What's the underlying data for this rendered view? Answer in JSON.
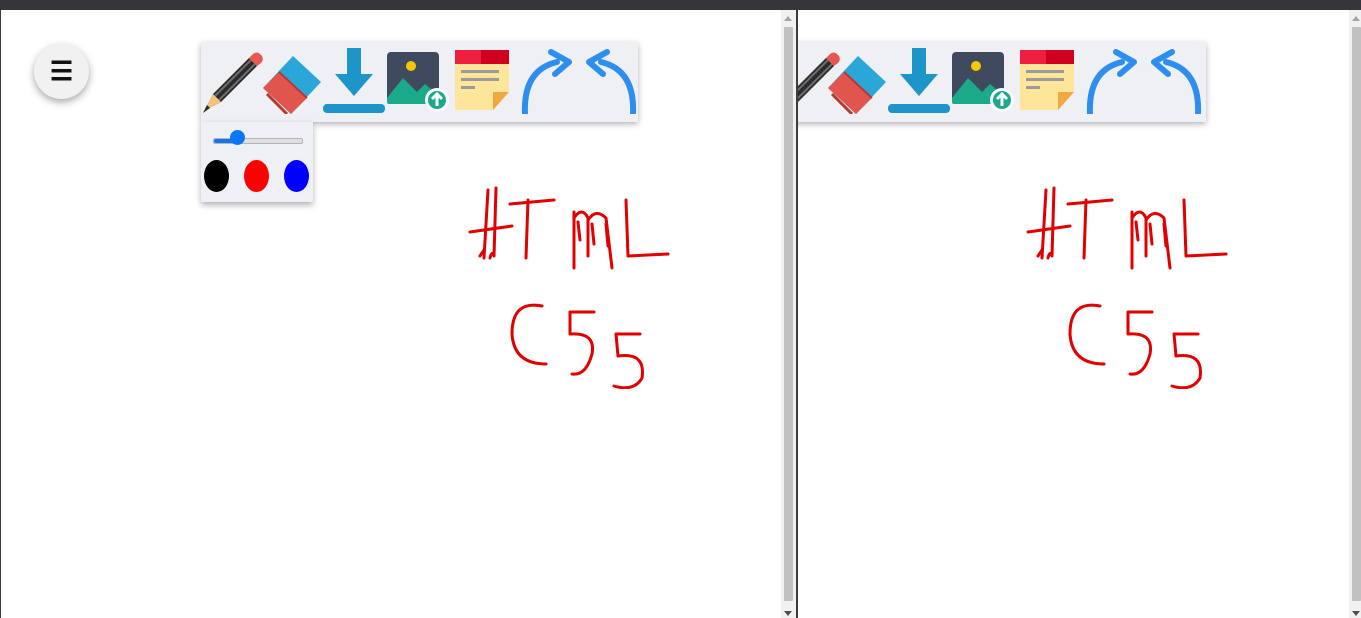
{
  "app": {
    "menu_icon": "hamburger-menu-icon",
    "menu_glyph": "☰"
  },
  "toolbar": {
    "tools": [
      {
        "name": "pencil-icon"
      },
      {
        "name": "eraser-icon"
      },
      {
        "name": "download-icon"
      },
      {
        "name": "image-upload-icon"
      },
      {
        "name": "sticky-note-icon"
      },
      {
        "name": "redo-icon"
      },
      {
        "name": "undo-icon"
      }
    ]
  },
  "pen_settings": {
    "stroke_size_fraction": 0.28,
    "colors": [
      "#000000",
      "#ff0000",
      "#0000ff"
    ]
  },
  "canvas": {
    "ink_color": "#e00000",
    "handwriting": [
      "HTML",
      "CSS"
    ]
  }
}
